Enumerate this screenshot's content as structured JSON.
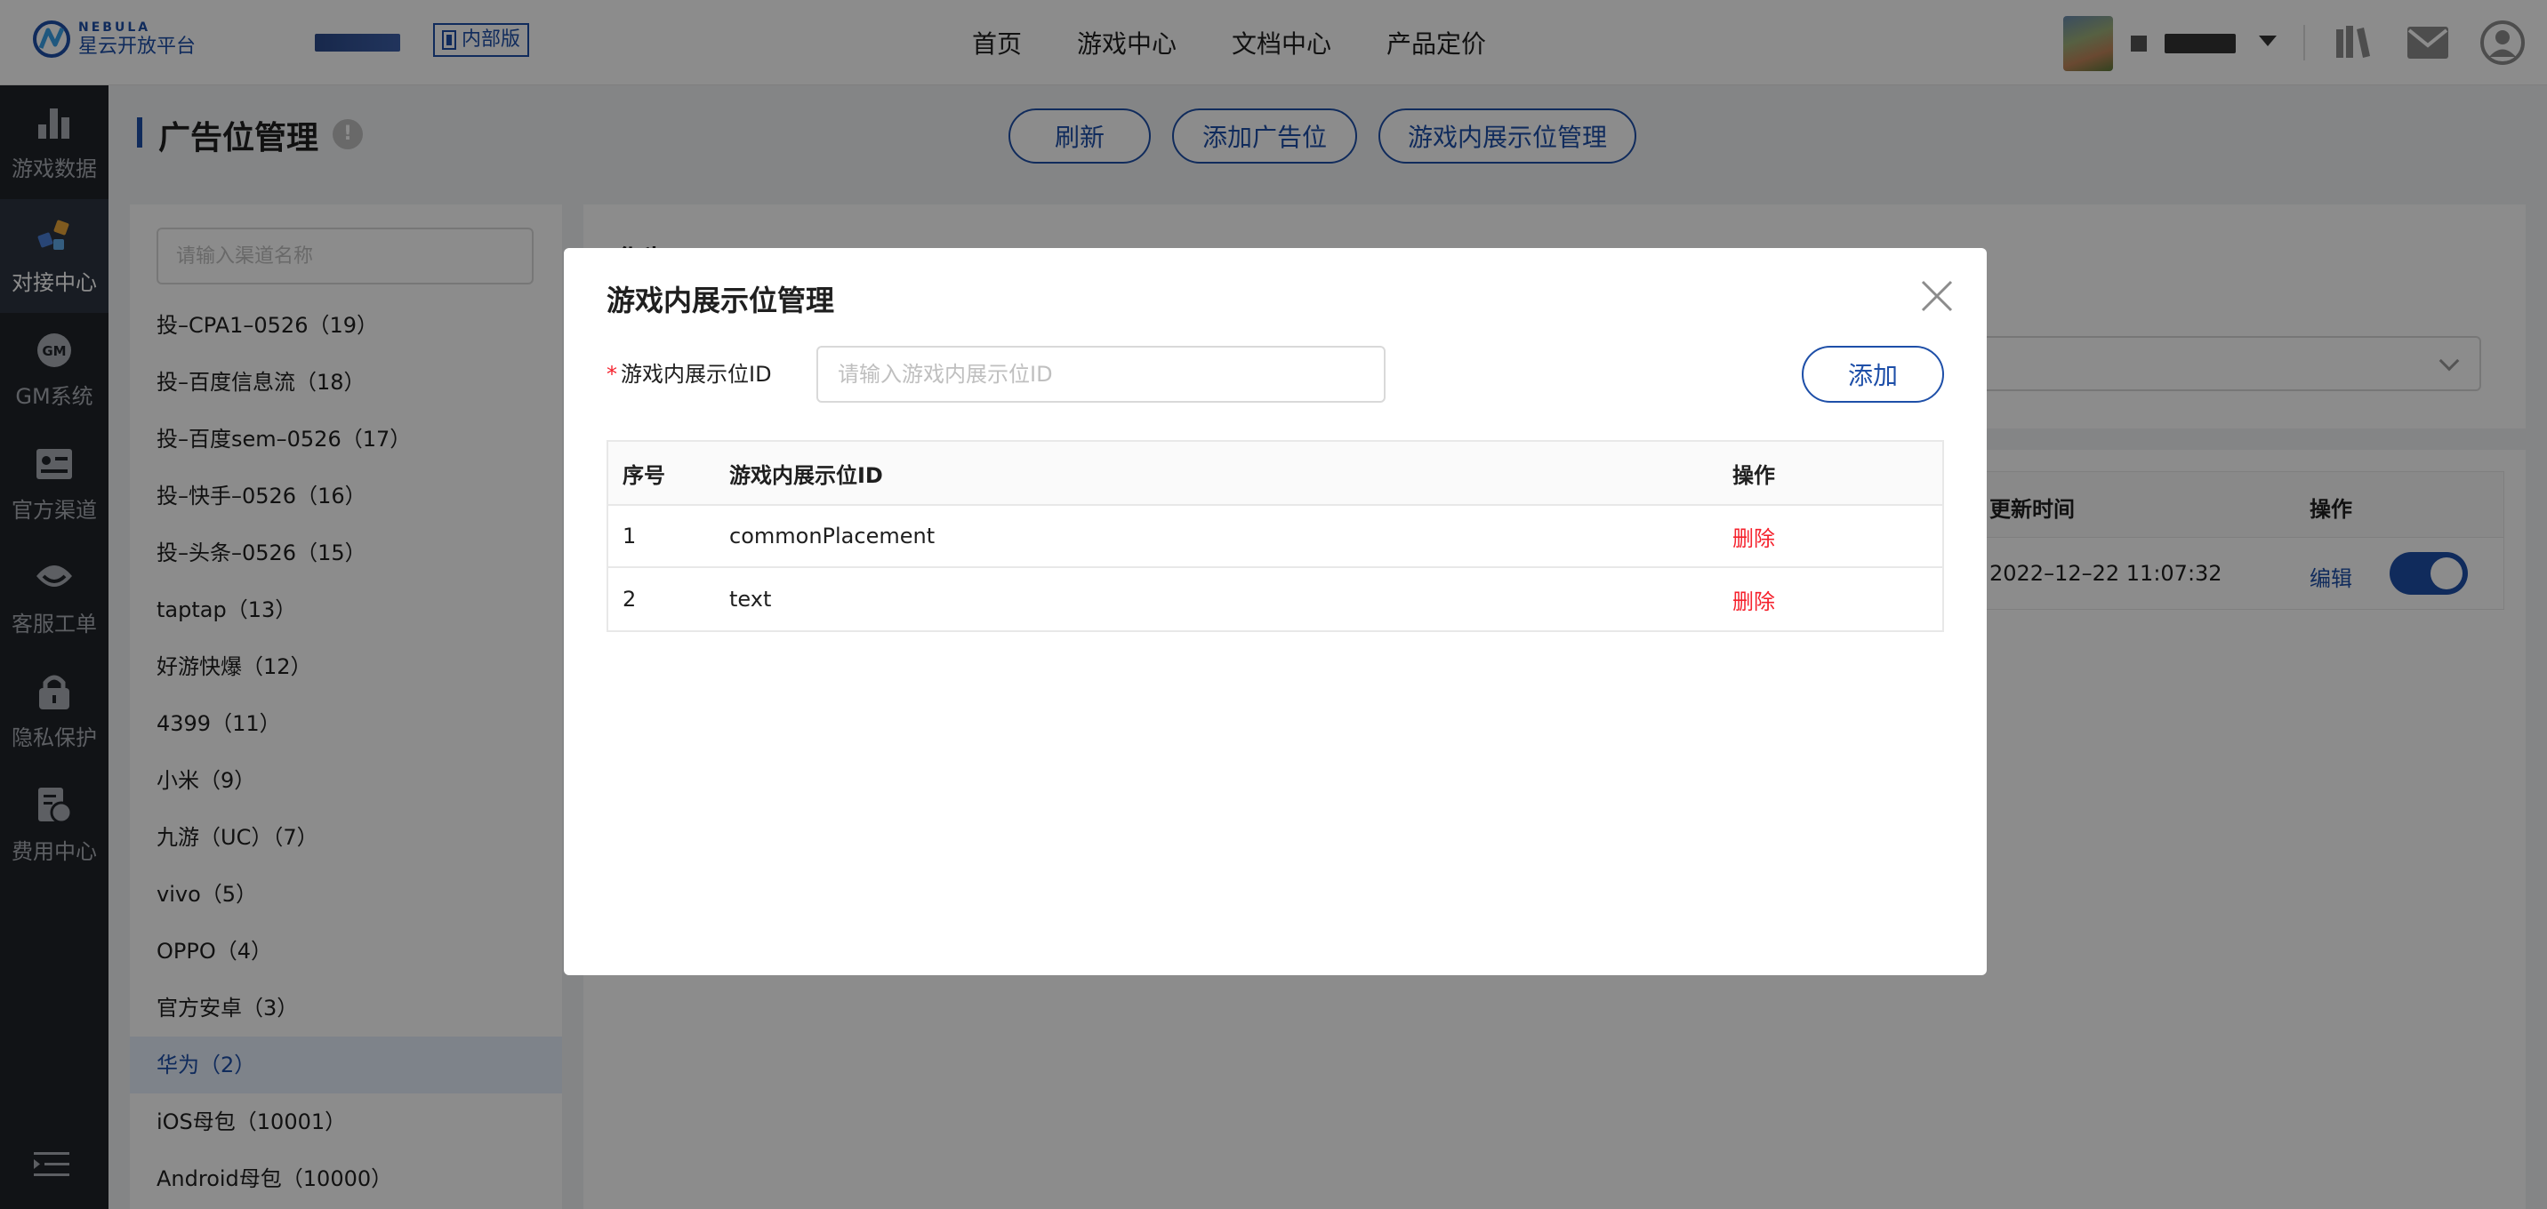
{
  "brand": {
    "en": "NEBULA",
    "cn": "星云开放平台",
    "badge": "内部版"
  },
  "topnav": {
    "items": [
      "首页",
      "游戏中心",
      "文档中心",
      "产品定价"
    ]
  },
  "sidebar": {
    "items": [
      {
        "label": "游戏数据",
        "icon": "bar-chart-icon"
      },
      {
        "label": "对接中心",
        "icon": "integration-icon"
      },
      {
        "label": "GM系统",
        "icon": "gm-icon"
      },
      {
        "label": "官方渠道",
        "icon": "id-card-icon"
      },
      {
        "label": "客服工单",
        "icon": "customer-service-icon"
      },
      {
        "label": "隐私保护",
        "icon": "lock-icon"
      },
      {
        "label": "费用中心",
        "icon": "billing-icon"
      }
    ],
    "active_index": 1,
    "gm_glyph": "GM"
  },
  "page": {
    "title": "广告位管理",
    "info_glyph": "!",
    "buttons": {
      "refresh": "刷新",
      "add_slot": "添加广告位",
      "ingame_manage": "游戏内展示位管理"
    }
  },
  "channels": {
    "search_placeholder": "请输入渠道名称",
    "items": [
      "投–CPA1–0526（19）",
      "投–百度信息流（18）",
      "投–百度sem–0526（17）",
      "投–快手–0526（16）",
      "投–头条–0526（15）",
      "taptap（13）",
      "好游快爆（12）",
      "4399（11）",
      "小米（9）",
      "九游（UC）（7）",
      "vivo（5）",
      "OPPO（4）",
      "官方安卓（3）",
      "华为（2）",
      "iOS母包（10001）",
      "Android母包（10000）"
    ],
    "active_index": 13
  },
  "content": {
    "title": "华为",
    "table": {
      "headers": {
        "updated": "更新时间",
        "action": "操作"
      },
      "rows": [
        {
          "updated": "2022–12–22 11:07:32",
          "edit": "编辑",
          "enabled": true
        }
      ]
    }
  },
  "modal": {
    "title": "游戏内展示位管理",
    "field_label": "游戏内展示位ID",
    "required_mark": "*",
    "input_placeholder": "请输入游戏内展示位ID",
    "input_value": "",
    "add_label": "添加",
    "table": {
      "headers": [
        "序号",
        "游戏内展示位ID",
        "操作"
      ],
      "rows": [
        {
          "index": "1",
          "id": "commonPlacement",
          "action": "删除"
        },
        {
          "index": "2",
          "id": "text",
          "action": "删除"
        }
      ]
    }
  },
  "colors": {
    "primary": "#1e4fa8",
    "danger": "#f5222d",
    "sidebar_bg": "#1f2329",
    "overlay": "rgba(0,0,0,0.45)"
  }
}
